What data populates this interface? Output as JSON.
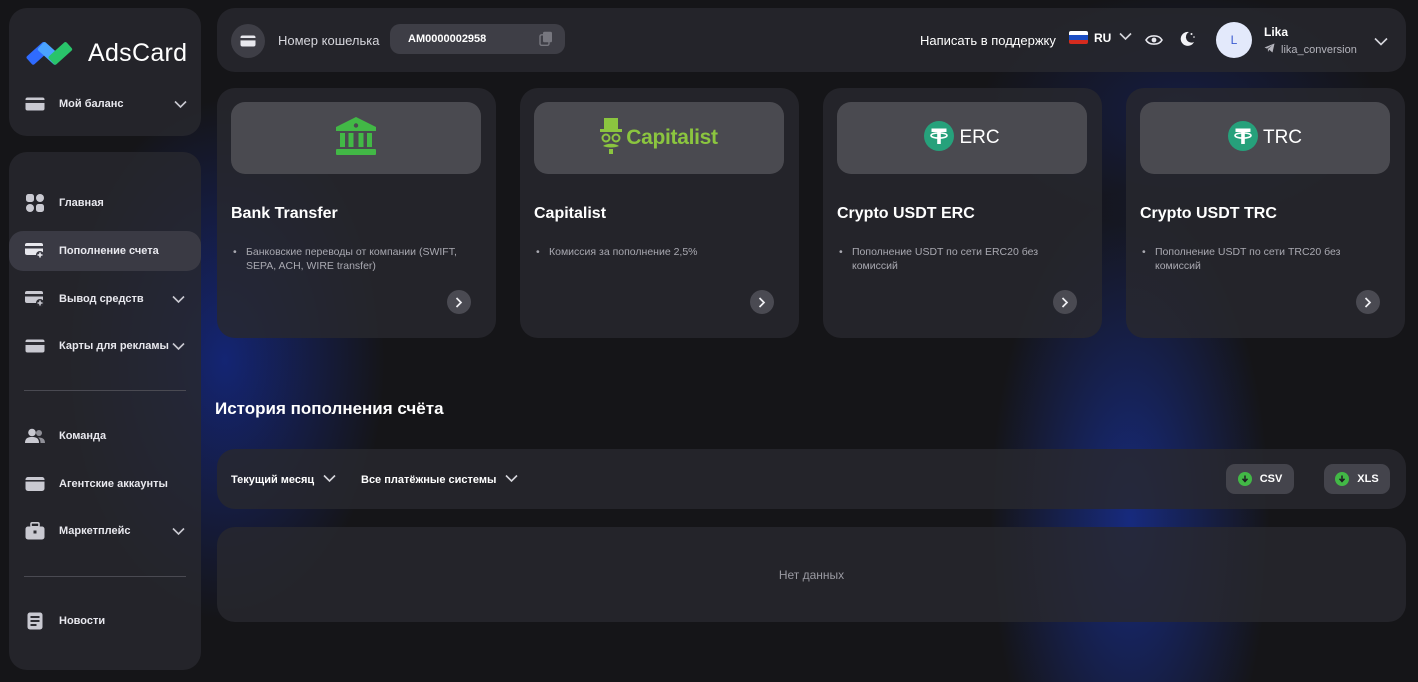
{
  "brand": {
    "name": "AdsCard"
  },
  "sidebar": {
    "balance": {
      "label": "Мой баланс"
    },
    "items": [
      {
        "label": "Главная",
        "icon": "grid-icon"
      },
      {
        "label": "Пополнение счета",
        "icon": "card-plus-icon",
        "active": true
      },
      {
        "label": "Вывод средств",
        "icon": "card-minus-icon"
      },
      {
        "label": "Карты для рекламы",
        "icon": "card-icon"
      },
      {
        "label": "Команда",
        "icon": "team-icon"
      },
      {
        "label": "Агентские аккаунты",
        "icon": "wallet-icon"
      },
      {
        "label": "Маркетплейс",
        "icon": "briefcase-icon"
      },
      {
        "label": "Новости",
        "icon": "news-icon"
      }
    ]
  },
  "header": {
    "wallet_label": "Номер кошелька",
    "wallet_number": "AM0000002958",
    "support": "Написать в поддержку",
    "language": "RU",
    "user": {
      "initial": "L",
      "name": "Lika",
      "handle": "lika_conversion"
    }
  },
  "payment_methods": [
    {
      "title": "Bank Transfer",
      "description": "Банковские переводы от компании (SWIFT, SEPA, ACH, WIRE transfer)",
      "logo": "bank-icon"
    },
    {
      "title": "Capitalist",
      "description": "Комиссия за пополнение 2,5%",
      "logo_text": "Capitalist"
    },
    {
      "title": "Crypto USDT ERC",
      "description": "Пополнение USDT по сети ERC20 без комиссий",
      "logo_text": "ERC"
    },
    {
      "title": "Crypto USDT TRC",
      "description": "Пополнение USDT по сети TRC20 без комиссий",
      "logo_text": "TRC"
    }
  ],
  "history": {
    "title": "История пополнения счёта",
    "filter_period": "Текущий месяц",
    "filter_system": "Все платёжные системы",
    "export_csv": "CSV",
    "export_xls": "XLS",
    "empty": "Нет данных"
  },
  "colors": {
    "accent_green": "#42b846",
    "tether_green": "#26a17b",
    "capitalist_green": "#8bc53f",
    "logo_blue": "#2f6bff",
    "logo_green": "#29c46a"
  }
}
